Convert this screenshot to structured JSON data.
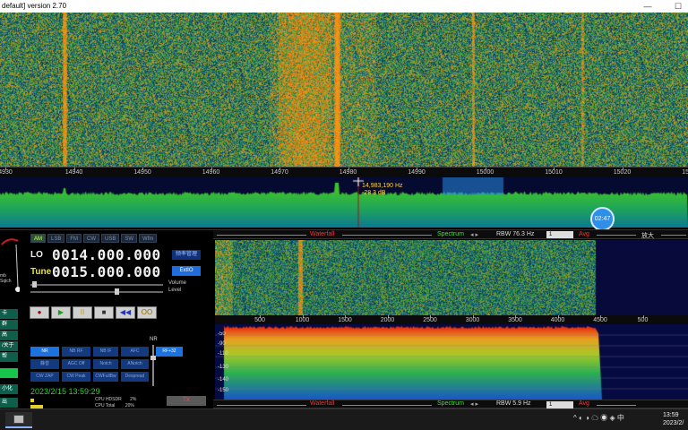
{
  "window": {
    "title": "default] version 2.70"
  },
  "main_scale": {
    "ticks": [
      "4930",
      "14940",
      "14950",
      "14960",
      "14970",
      "14980",
      "14990",
      "15000",
      "15010",
      "15020",
      "15030"
    ]
  },
  "cursor_readout": {
    "freq": "14,983,190 Hz",
    "level": "-28.3 dB"
  },
  "timer_badge": "02:47",
  "left_strip": {
    "meter_label": "mb\nSqlch",
    "buttons": [
      "卡",
      "群",
      "高",
      "/关于",
      "帮",
      "",
      "小化",
      "出"
    ]
  },
  "modes": [
    "AM",
    "LSB",
    "FM",
    "CW",
    "USB",
    "SW",
    "Wfm"
  ],
  "active_mode": "AM",
  "lo": {
    "label": "LO",
    "value": "0014.000.000"
  },
  "tune": {
    "label": "Tune",
    "value": "0015.000.000"
  },
  "side_buttons": {
    "top": "频率管理",
    "ext": "ExtIO"
  },
  "sliders": {
    "volume": "Volume",
    "level": "Level"
  },
  "transport": {
    "record": "●",
    "play": "▶",
    "pause": "II",
    "stop": "■",
    "rewind": "◀◀",
    "loop": "OO"
  },
  "dsp": {
    "row1": [
      "NR",
      "NB RF",
      "NB IF",
      "AFC",
      "RF+32"
    ],
    "row2": [
      "静音",
      "AGC Off",
      "Notch",
      "ANotch"
    ],
    "row3": [
      "CW ZAP",
      "CW Peak",
      "CWFullBw",
      "Despread"
    ],
    "nr_caption": "NR",
    "active": [
      "NR",
      "RF+32"
    ]
  },
  "status": {
    "datetime": "2023/2/15 13:59:29",
    "cpu_hdsdr": "CPU HDSDR",
    "cpu_hdsdr_val": "2%",
    "cpu_total": "CPU Total",
    "cpu_total_val": "20%",
    "tx": "TX"
  },
  "toolbar1": {
    "waterfall": "Waterfall",
    "spectrum": "Spectrum",
    "rbw": "RBW 76.3 Hz",
    "rbw_sel": "1",
    "avg": "Avg",
    "zoom": "放大"
  },
  "toolbar2": {
    "waterfall": "Waterfall",
    "spectrum": "Spectrum",
    "rbw": "RBW 5.9 Hz",
    "rbw_sel": "1",
    "avg": "Avg"
  },
  "zoom_scale": {
    "ticks": [
      "500",
      "1000",
      "1500",
      "2000",
      "2500",
      "3000",
      "3500",
      "4000",
      "4500",
      "500"
    ]
  },
  "db_labels": [
    "-50",
    "-90",
    "-110",
    "-130",
    "-140",
    "-150"
  ],
  "tray": {
    "icons": "^ ◐ ◑ ☁ ◉ ◈ 中"
  },
  "clock": {
    "time": "13:59",
    "date": "2023/2/"
  },
  "colors": {
    "accent_blue": "#1e72e0",
    "status_green": "#36d03a",
    "waterfall_red": "#ff3030"
  }
}
